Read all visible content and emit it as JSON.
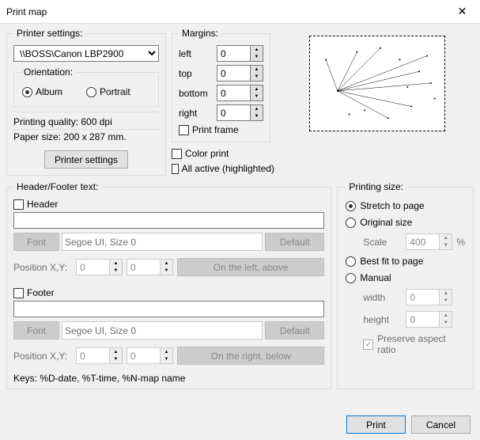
{
  "title": "Print map",
  "printer_settings": {
    "legend": "Printer settings:",
    "printer": "\\\\BOSS\\Canon LBP2900",
    "orientation_legend": "Orientation:",
    "album": "Album",
    "portrait": "Portrait",
    "quality": "Printing quality: 600 dpi",
    "paper_size": "Paper size: 200 x 287 mm.",
    "button": "Printer settings"
  },
  "margins": {
    "legend": "Margins:",
    "left_lbl": "left",
    "top_lbl": "top",
    "bottom_lbl": "bottom",
    "right_lbl": "right",
    "left": "0",
    "top": "0",
    "bottom": "0",
    "right": "0",
    "print_frame": "Print frame"
  },
  "options": {
    "color_print": "Color print",
    "all_active": "All active (highlighted)"
  },
  "header_footer": {
    "legend": "Header/Footer text:",
    "header_cb": "Header",
    "footer_cb": "Footer",
    "font_btn": "Font",
    "font_value": "Segoe UI, Size 0",
    "default_btn": "Default",
    "position_lbl": "Position X,Y:",
    "pos_x": "0",
    "pos_y": "0",
    "hint_above": "On the left, above",
    "hint_below": "On the right, below",
    "keys": "Keys: %D-date, %T-time, %N-map name"
  },
  "printing_size": {
    "legend": "Printing size:",
    "stretch": "Stretch to page",
    "original": "Original size",
    "scale_lbl": "Scale",
    "scale": "400",
    "pct": "%",
    "best_fit": "Best fit to page",
    "manual": "Manual",
    "width_lbl": "width",
    "height_lbl": "height",
    "width": "0",
    "height": "0",
    "preserve": "Preserve aspect ratio"
  },
  "footer": {
    "print": "Print",
    "cancel": "Cancel"
  }
}
